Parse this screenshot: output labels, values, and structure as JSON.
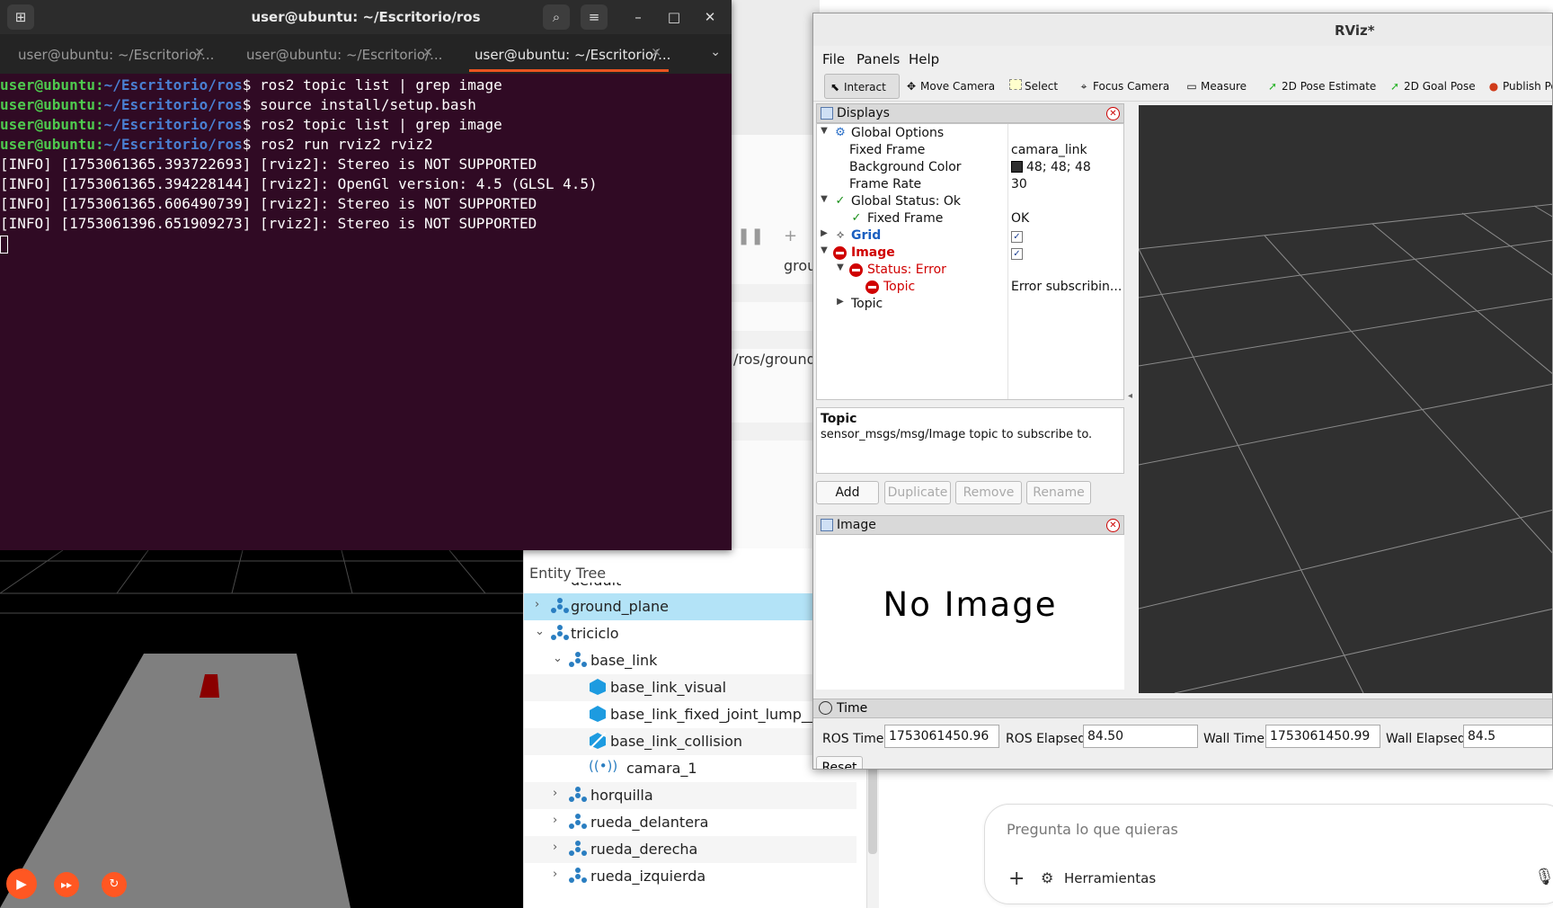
{
  "terminal": {
    "title": "user@ubuntu: ~/Escritorio/ros",
    "tabs": [
      {
        "label": "user@ubuntu: ~/Escritorio/..."
      },
      {
        "label": "user@ubuntu: ~/Escritorio/..."
      },
      {
        "label": "user@ubuntu: ~/Escritorio/..."
      }
    ],
    "prompt_user": "user@ubuntu",
    "prompt_path": "~/Escritorio/ros",
    "commands": [
      "ros2 topic list | grep image",
      "source install/setup.bash",
      "ros2 topic list | grep image",
      "ros2 run rviz2 rviz2"
    ],
    "output": [
      "[INFO] [1753061365.393722693] [rviz2]: Stereo is NOT SUPPORTED",
      "[INFO] [1753061365.394228144] [rviz2]: OpenGl version: 4.5 (GLSL 4.5)",
      "[INFO] [1753061365.606490739] [rviz2]: Stereo is NOT SUPPORTED",
      "[INFO] [1753061396.651909273] [rviz2]: Stereo is NOT SUPPORTED"
    ]
  },
  "rviz": {
    "title": "RViz*",
    "menu": {
      "file": "File",
      "panels": "Panels",
      "help": "Help"
    },
    "toolbar": {
      "interact": "Interact",
      "move_camera": "Move Camera",
      "select": "Select",
      "focus_camera": "Focus Camera",
      "measure": "Measure",
      "pose_estimate": "2D Pose Estimate",
      "goal_pose": "2D Goal Pose",
      "publish_point": "Publish Po"
    },
    "displays": {
      "title": "Displays",
      "global_options": "Global Options",
      "fixed_frame_label": "Fixed Frame",
      "fixed_frame_value": "camara_link",
      "background_color_label": "Background Color",
      "background_color_value": "48; 48; 48",
      "frame_rate_label": "Frame Rate",
      "frame_rate_value": "30",
      "global_status": "Global Status: Ok",
      "status_fixed_frame": "Fixed Frame",
      "status_fixed_frame_value": "OK",
      "grid": "Grid",
      "image": "Image",
      "status_error": "Status: Error",
      "topic_error": "Topic",
      "topic_error_value": "Error subscribin...",
      "topic": "Topic"
    },
    "description": {
      "title": "Topic",
      "text": "sensor_msgs/msg/Image topic to subscribe to."
    },
    "buttons": {
      "add": "Add",
      "duplicate": "Duplicate",
      "remove": "Remove",
      "rename": "Rename"
    },
    "image_panel": {
      "title": "Image",
      "no_image": "No Image"
    },
    "time": {
      "title": "Time",
      "ros_time_label": "ROS Time:",
      "ros_time": "1753061450.96",
      "ros_elapsed_label": "ROS Elapsed:",
      "ros_elapsed": "84.50",
      "wall_time_label": "Wall Time:",
      "wall_time": "1753061450.99",
      "wall_elapsed_label": "Wall Elapsed:",
      "wall_elapsed": "84.5",
      "reset": "Reset"
    }
  },
  "entity_tree": {
    "title": "Entity Tree",
    "items": [
      {
        "label": "default"
      },
      {
        "label": "ground_plane"
      },
      {
        "label": "triciclo"
      },
      {
        "label": "base_link"
      },
      {
        "label": "base_link_visual"
      },
      {
        "label": "base_link_fixed_joint_lump__ca"
      },
      {
        "label": "base_link_collision"
      },
      {
        "label": "camara_1"
      },
      {
        "label": "horquilla"
      },
      {
        "label": "rueda_delantera"
      },
      {
        "label": "rueda_derecha"
      },
      {
        "label": "rueda_izquierda"
      }
    ]
  },
  "browser": {
    "snippet_1": "grou",
    "snippet_2": "/ros/ground_",
    "chat_placeholder": "Pregunta lo que quieras",
    "tools_label": "Herramientas"
  },
  "colors": {
    "terminal_bg": "#300a24",
    "accent": "#e95420",
    "prompt_user": "#4ec94e",
    "prompt_path": "#4a7fd1",
    "rviz_bg": "#303030",
    "error": "#d00000"
  }
}
